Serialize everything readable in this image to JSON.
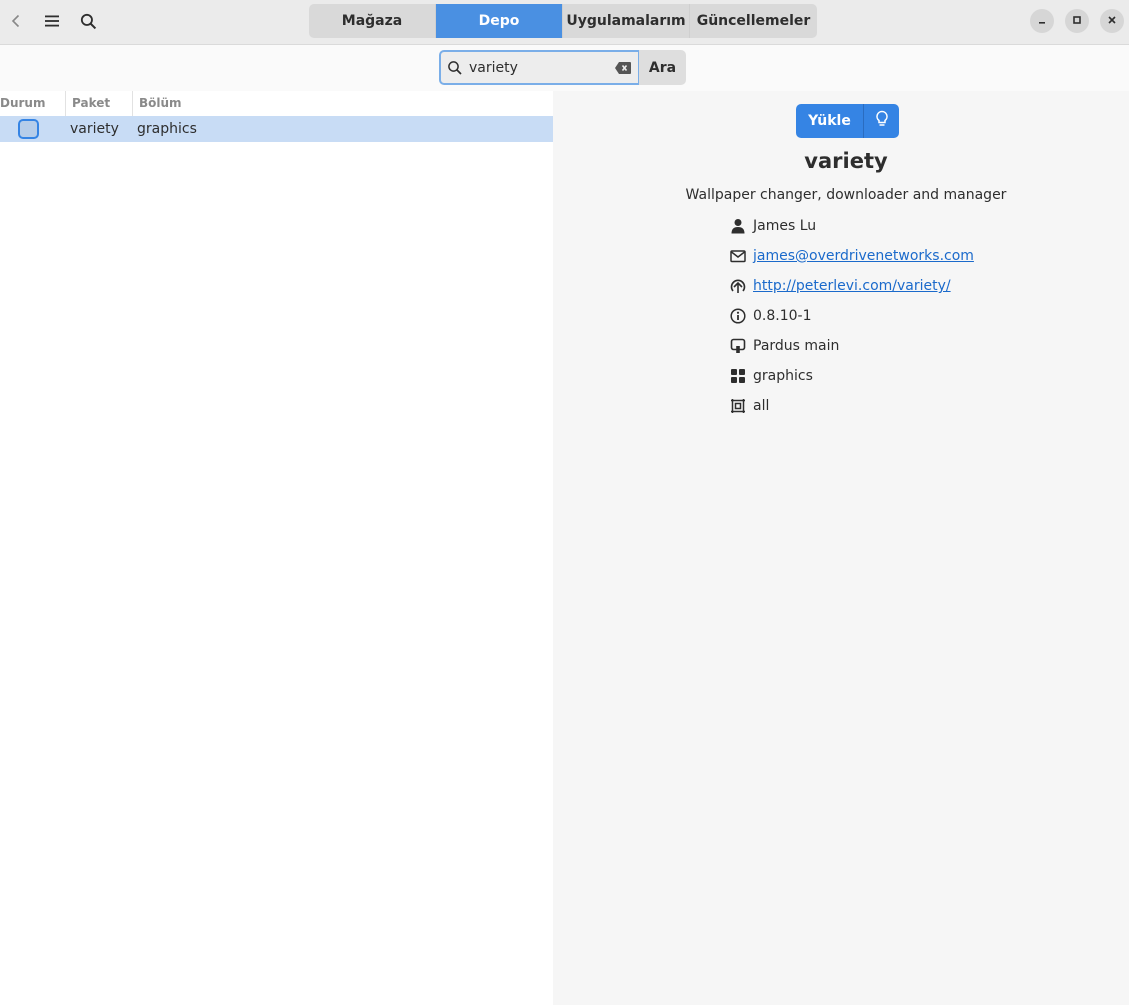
{
  "header": {
    "tabs": [
      {
        "label": "Mağaza",
        "active": false
      },
      {
        "label": "Depo",
        "active": true
      },
      {
        "label": "Uygulamalarım",
        "active": false
      },
      {
        "label": "Güncellemeler",
        "active": false
      }
    ],
    "icons": {
      "back": "chevron-left-icon",
      "menu": "hamburger-menu-icon",
      "search": "search-icon",
      "minimize": "minimize-icon",
      "maximize": "maximize-icon",
      "close": "close-icon"
    }
  },
  "search": {
    "value": "variety",
    "button_label": "Ara"
  },
  "table": {
    "columns": [
      "Durum",
      "Paket",
      "Bölüm"
    ],
    "rows": [
      {
        "status_checked": false,
        "package": "variety",
        "section": "graphics"
      }
    ]
  },
  "detail": {
    "install_label": "Yükle",
    "title": "variety",
    "description": "Wallpaper changer, downloader and manager",
    "maintainer": "James Lu",
    "email": "james@overdrivenetworks.com",
    "homepage": "http://peterlevi.com/variety/",
    "version": "0.8.10-1",
    "origin": "Pardus main",
    "section": "graphics",
    "architecture": "all"
  },
  "colors": {
    "accent": "#3584e4",
    "tab_active": "#4a90e2",
    "row_selected": "#c8dcf5",
    "link": "#1b6acb"
  }
}
